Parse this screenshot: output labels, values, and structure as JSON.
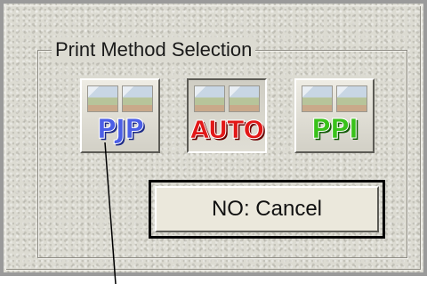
{
  "dialog": {
    "group_title": "Print Method Selection",
    "methods": [
      {
        "label": "PJP",
        "color": "#4b5ee6",
        "selected": false
      },
      {
        "label": "AUTO",
        "color": "#e21818",
        "selected": true
      },
      {
        "label": "PPI",
        "color": "#39c21a",
        "selected": false
      }
    ],
    "cancel_label": "NO: Cancel"
  },
  "colors": {
    "background": "#dcdbd2",
    "frame_border": "#9a9a9a",
    "cancel_focus_border": "#000000"
  }
}
